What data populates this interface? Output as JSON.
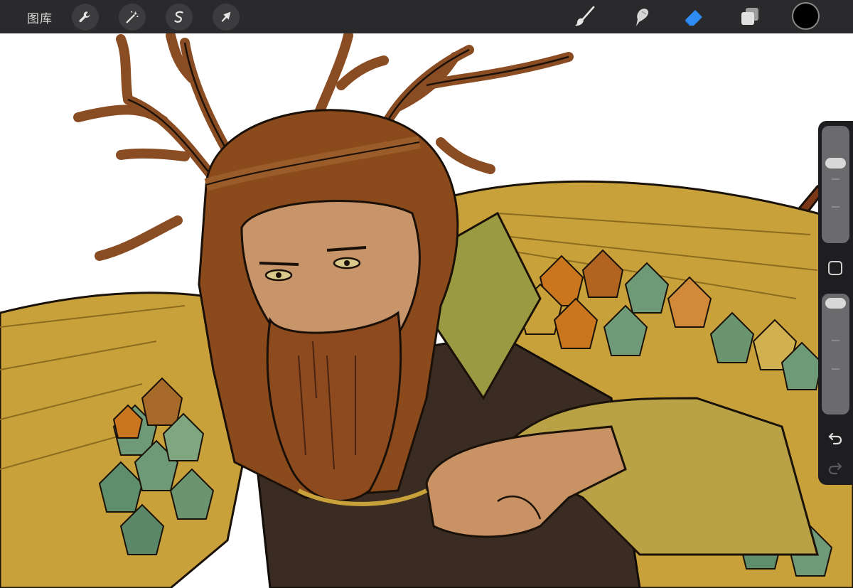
{
  "app": {
    "gallery_label": "图库"
  },
  "toolbar": {
    "left_tools": [
      {
        "name": "actions",
        "icon": "wrench-icon"
      },
      {
        "name": "adjustments",
        "icon": "magic-wand-icon"
      },
      {
        "name": "selection",
        "icon": "selection-s-icon"
      },
      {
        "name": "transform",
        "icon": "arrow-cursor-icon"
      }
    ],
    "right_tools": [
      {
        "name": "brush",
        "icon": "brush-icon",
        "active": false
      },
      {
        "name": "smudge",
        "icon": "smudge-finger-icon",
        "active": false
      },
      {
        "name": "eraser",
        "icon": "eraser-icon",
        "active": true
      },
      {
        "name": "layers",
        "icon": "layers-icon",
        "active": false
      }
    ],
    "current_color": "#000000",
    "active_tool_color": "#2f8cf5"
  },
  "sidebar": {
    "brush_size_level": 0.94,
    "opacity_level": 0.94,
    "modify_button_icon": "square-modify-icon",
    "undo_icon": "undo-icon",
    "redo_icon": "redo-icon",
    "redo_enabled": false
  },
  "colors": {
    "toolbar_bg": "#2a2a2c",
    "canvas_bg": "#ffffff",
    "hair": "#8a4a1c",
    "cloak": "#c8a33c",
    "leaf_green": "#6f9a78",
    "leaf_orange": "#c9761e",
    "skin": "#c8946a",
    "robe": "#9a9a42"
  }
}
